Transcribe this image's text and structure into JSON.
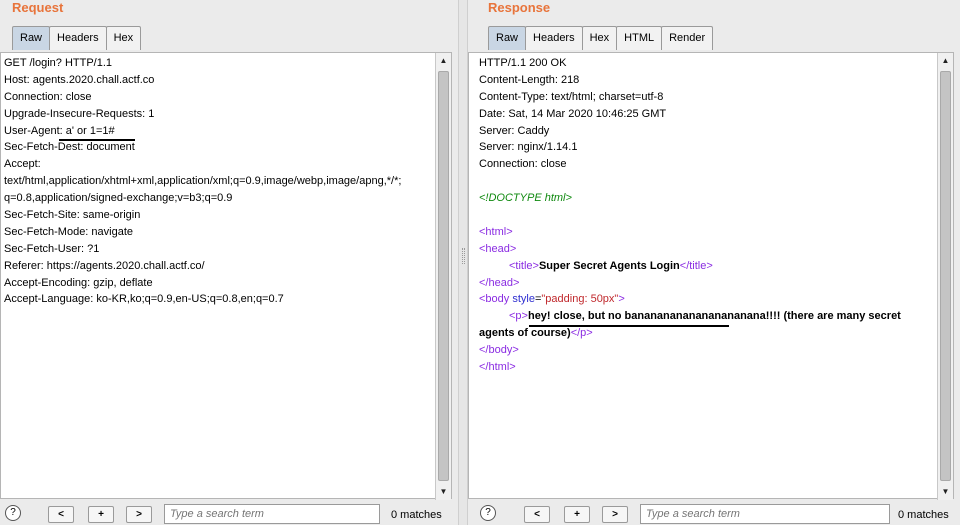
{
  "request": {
    "title": "Request",
    "tabs": [
      "Raw",
      "Headers",
      "Hex"
    ],
    "active_tab": "Raw",
    "lines": [
      "GET /login? HTTP/1.1",
      "Host: agents.2020.chall.actf.co",
      "Connection: close",
      "Upgrade-Insecure-Requests: 1",
      "User-Agent: a' or 1=1#",
      "Sec-Fetch-Dest: document",
      "Accept:",
      "text/html,application/xhtml+xml,application/xml;q=0.9,image/webp,image/apng,*/*;",
      "q=0.8,application/signed-exchange;v=b3;q=0.9",
      "Sec-Fetch-Site: same-origin",
      "Sec-Fetch-Mode: navigate",
      "Sec-Fetch-User: ?1",
      "Referer: https://agents.2020.chall.actf.co/",
      "Accept-Encoding: gzip, deflate",
      "Accept-Language: ko-KR,ko;q=0.9,en-US;q=0.8,en;q=0.7"
    ],
    "search": {
      "placeholder": "Type a search term",
      "matches": "0 matches"
    }
  },
  "response": {
    "title": "Response",
    "tabs": [
      "Raw",
      "Headers",
      "Hex",
      "HTML",
      "Render"
    ],
    "active_tab": "Raw",
    "headers": [
      "HTTP/1.1 200 OK",
      "Content-Length: 218",
      "Content-Type: text/html; charset=utf-8",
      "Date: Sat, 14 Mar 2020 10:46:25 GMT",
      "Server: Caddy",
      "Server: nginx/1.14.1",
      "Connection: close"
    ],
    "body": {
      "doctype": "<!DOCTYPE html>",
      "html_open": "<html>",
      "head_open": "<head>",
      "title_open": "<title>",
      "title_text": "Super Secret Agents Login",
      "title_close": "</title>",
      "head_close": "</head>",
      "body_tag": "<body ",
      "body_attr_name": "style",
      "body_attr_eq": "=",
      "body_attr_value": "\"padding: 50px\"",
      "body_tag_end": ">",
      "p_open": "<p>",
      "p_text": "hey! close, but no banananananananananana!!!! (there are many secret agents of course)",
      "p_close": "</p>",
      "body_close": "</body>",
      "html_close": "</html>"
    },
    "search": {
      "placeholder": "Type a search term",
      "matches": "0 matches"
    }
  },
  "buttons": {
    "help": "?",
    "prev": "<",
    "add": "+",
    "next": ">"
  },
  "colors": {
    "title": "#e8743b",
    "active_tab": "#c9d6e4",
    "tag": "#8a2be2",
    "attr_name": "#2f2fd0",
    "attr_value": "#c0282c",
    "doctype": "#118a11"
  }
}
